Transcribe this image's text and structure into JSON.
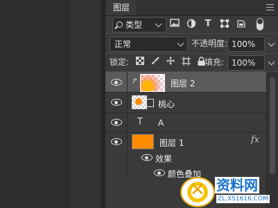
{
  "panel": {
    "title": "图层"
  },
  "filter": {
    "label": "类型",
    "icons": [
      "image-filter-icon",
      "adjustment-filter-icon",
      "text-filter-icon",
      "shape-filter-icon",
      "smartobject-filter-icon"
    ]
  },
  "blend": {
    "mode": "正常",
    "opacity_label": "不透明度:",
    "opacity_value": "100%"
  },
  "lock": {
    "label": "锁定:",
    "fill_label": "填充:",
    "fill_value": "100%"
  },
  "layers": [
    {
      "name": "图层 2",
      "selected": true
    },
    {
      "name": "桃心",
      "selected": false
    },
    {
      "name": "A",
      "selected": false
    },
    {
      "name": "图层 1",
      "selected": false,
      "fx": "fx"
    }
  ],
  "effects": {
    "header": "效果",
    "items": [
      "颜色叠加"
    ]
  },
  "watermark": {
    "title": "资料网",
    "url": "ZL.XS1616.COM"
  },
  "colors": {
    "accent_orange": "#ff8c00",
    "panel_bg": "#3a3a3a",
    "selected_row": "#5a5a5a"
  }
}
